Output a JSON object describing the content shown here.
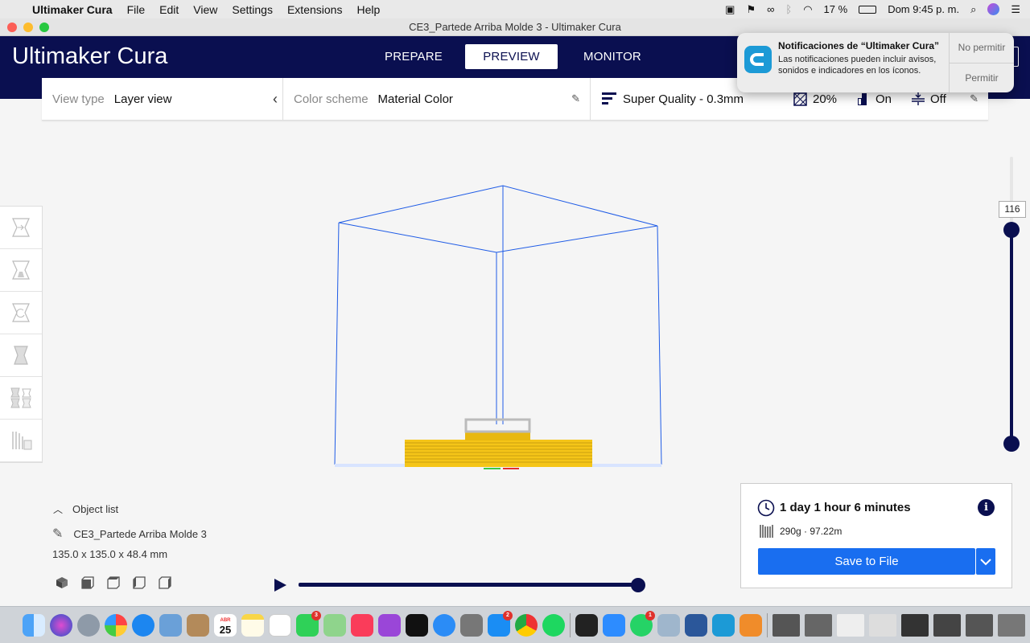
{
  "menubar": {
    "app_name": "Ultimaker Cura",
    "items": [
      "File",
      "Edit",
      "View",
      "Settings",
      "Extensions",
      "Help"
    ],
    "battery": "17 %",
    "clock": "Dom 9:45 p. m."
  },
  "window": {
    "title": "CE3_Partede Arriba Molde 3 - Ultimaker Cura"
  },
  "header": {
    "logo_bold": "Ultimaker",
    "logo_light": "Cura",
    "stages": [
      "PREPARE",
      "PREVIEW",
      "MONITOR"
    ],
    "active_stage": "PREVIEW"
  },
  "toolbar": {
    "view_type_label": "View type",
    "view_type_value": "Layer view",
    "color_scheme_label": "Color scheme",
    "color_scheme_value": "Material Color",
    "profile": "Super Quality - 0.3mm",
    "infill": "20%",
    "support": "On",
    "adhesion": "Off"
  },
  "object_list": {
    "header": "Object list",
    "object_name": "CE3_Partede Arriba Molde 3",
    "dimensions": "135.0 x 135.0 x 48.4 mm"
  },
  "layer_slider": {
    "current_layer": "116",
    "position_fraction": 1.0
  },
  "playback": {
    "progress_fraction": 1.0
  },
  "job": {
    "print_time": "1 day 1 hour 6 minutes",
    "material": "290g · 97.22m",
    "save_button": "Save to File"
  },
  "notification": {
    "title": "Notificaciones de “Ultimaker Cura”",
    "body": "Las notificaciones pueden incluir avisos, sonidos e indicadores en los íconos.",
    "deny": "No permitir",
    "allow": "Permitir"
  },
  "dock": {
    "calendar_day": "25",
    "calendar_month": "ABR",
    "badges": {
      "messages": "3",
      "appstore": "2",
      "whatsapp": "1"
    }
  },
  "colors": {
    "header_bg": "#0a0f50",
    "accent_blue": "#196ef0",
    "layer_yellow": "#f5c518",
    "build_volume_line": "#1e5be6"
  }
}
